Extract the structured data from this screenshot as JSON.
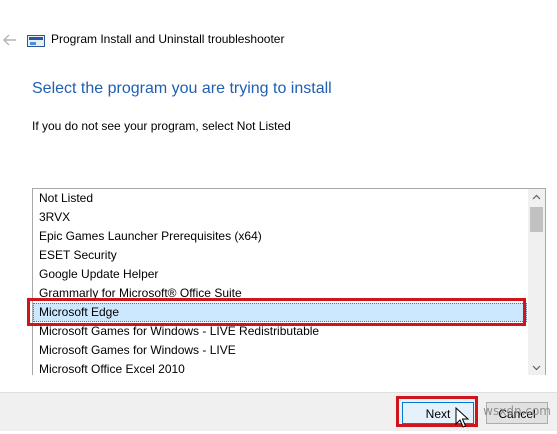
{
  "window": {
    "title": "Program Install and Uninstall troubleshooter",
    "back_icon": "back-arrow-icon",
    "app_icon": "troubleshooter-icon"
  },
  "main": {
    "heading": "Select the program you are trying to install",
    "instruction": "If you do not see your program, select Not Listed"
  },
  "programs": {
    "selected": "Microsoft Edge",
    "items": [
      "Not Listed",
      "3RVX",
      "Epic Games Launcher Prerequisites (x64)",
      "ESET Security",
      "Google Update Helper",
      "Grammarly for Microsoft® Office Suite",
      "Microsoft Edge",
      "Microsoft Games for Windows - LIVE Redistributable",
      "Microsoft Games for Windows - LIVE",
      "Microsoft Office Excel 2010"
    ]
  },
  "footer": {
    "next_label": "Next",
    "cancel_label": "Cancel"
  },
  "watermark": "wsxdn.com",
  "colors": {
    "heading": "#1f5fb4",
    "selection_bg": "#cce8ff",
    "annotation_red": "#d0141c"
  }
}
